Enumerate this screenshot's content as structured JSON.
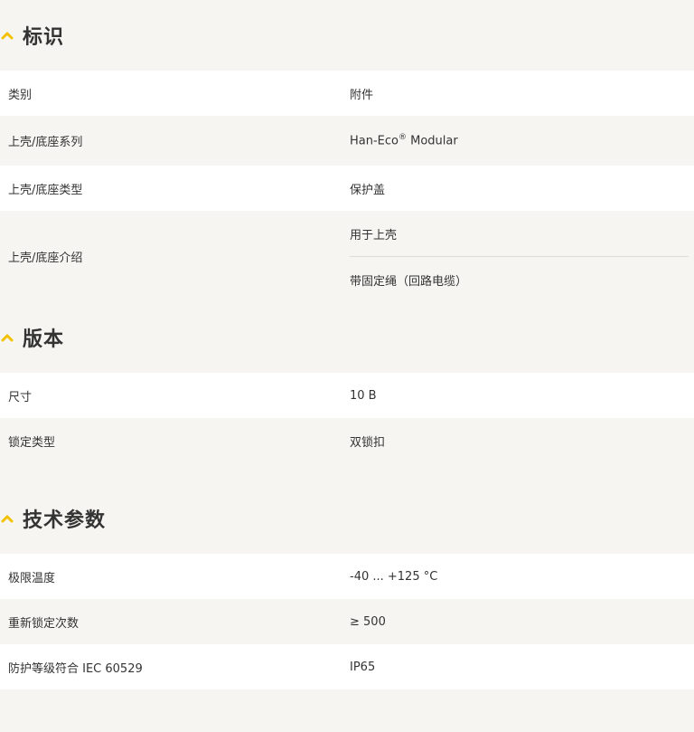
{
  "accent_color": "#f2c200",
  "sections": [
    {
      "title": "标识",
      "rows": [
        {
          "label": "类别",
          "value": "附件"
        },
        {
          "label": "上壳/底座系列",
          "value": "Han-Eco",
          "value_sup": "®",
          "value_suffix": " Modular"
        },
        {
          "label": "上壳/底座类型",
          "value": "保护盖"
        },
        {
          "label": "上壳/底座介绍",
          "values": [
            "用于上壳",
            "带固定绳（回路电缆）"
          ]
        }
      ]
    },
    {
      "title": "版本",
      "rows": [
        {
          "label": "尺寸",
          "value": "10 B"
        },
        {
          "label": "锁定类型",
          "value": "双锁扣"
        }
      ]
    },
    {
      "title": "技术参数",
      "rows": [
        {
          "label": "极限温度",
          "value": "-40 ... +125 °C"
        },
        {
          "label": "重新锁定次数",
          "value": "≥ 500"
        },
        {
          "label": "防护等级符合 IEC 60529",
          "value": "IP65"
        }
      ]
    }
  ]
}
